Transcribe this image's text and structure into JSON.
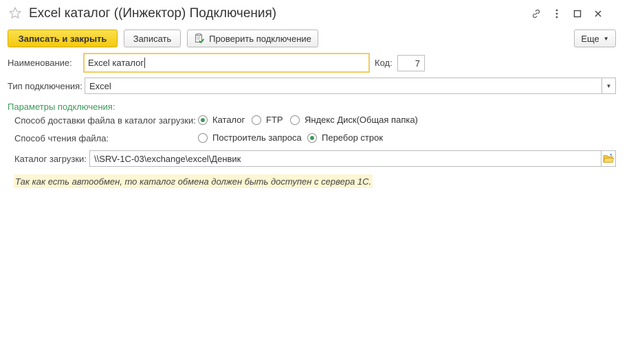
{
  "window": {
    "title": "Excel каталог ((Инжектор) Подключения)"
  },
  "toolbar": {
    "save_close_label": "Записать и закрыть",
    "save_label": "Записать",
    "check_connection_label": "Проверить подключение",
    "more_label": "Еще"
  },
  "form": {
    "name_label": "Наименование:",
    "name_value": "Excel каталог",
    "code_label": "Код:",
    "code_value": "7",
    "connection_type_label": "Тип подключения:",
    "connection_type_value": "Excel",
    "params_title": "Параметры подключения:",
    "delivery_label": "Способ доставки файла в каталог загрузки:",
    "delivery_options": [
      {
        "label": "Каталог",
        "selected": true
      },
      {
        "label": "FTP",
        "selected": false
      },
      {
        "label": "Яндекс Диск(Общая папка)",
        "selected": false
      }
    ],
    "read_label": "Способ чтения файла:",
    "read_options": [
      {
        "label": "Построитель запроса",
        "selected": false
      },
      {
        "label": "Перебор строк",
        "selected": true
      }
    ],
    "catalog_label": "Каталог загрузки:",
    "catalog_value": "\\\\SRV-1C-03\\exchange\\excel\\Денвик",
    "note": "Так как есть автообмен, то каталог обмена должен быть доступен с сервера 1С."
  },
  "colors": {
    "accent_yellow": "#f4c90d",
    "section_green": "#3b9a5a",
    "focus_border": "#f2cc5c",
    "note_bg": "#fdf6d3"
  },
  "icons": [
    "star-icon",
    "link-icon",
    "more-vertical-icon",
    "maximize-icon",
    "close-icon",
    "check-doc-icon",
    "chevron-down-icon",
    "folder-open-icon"
  ]
}
